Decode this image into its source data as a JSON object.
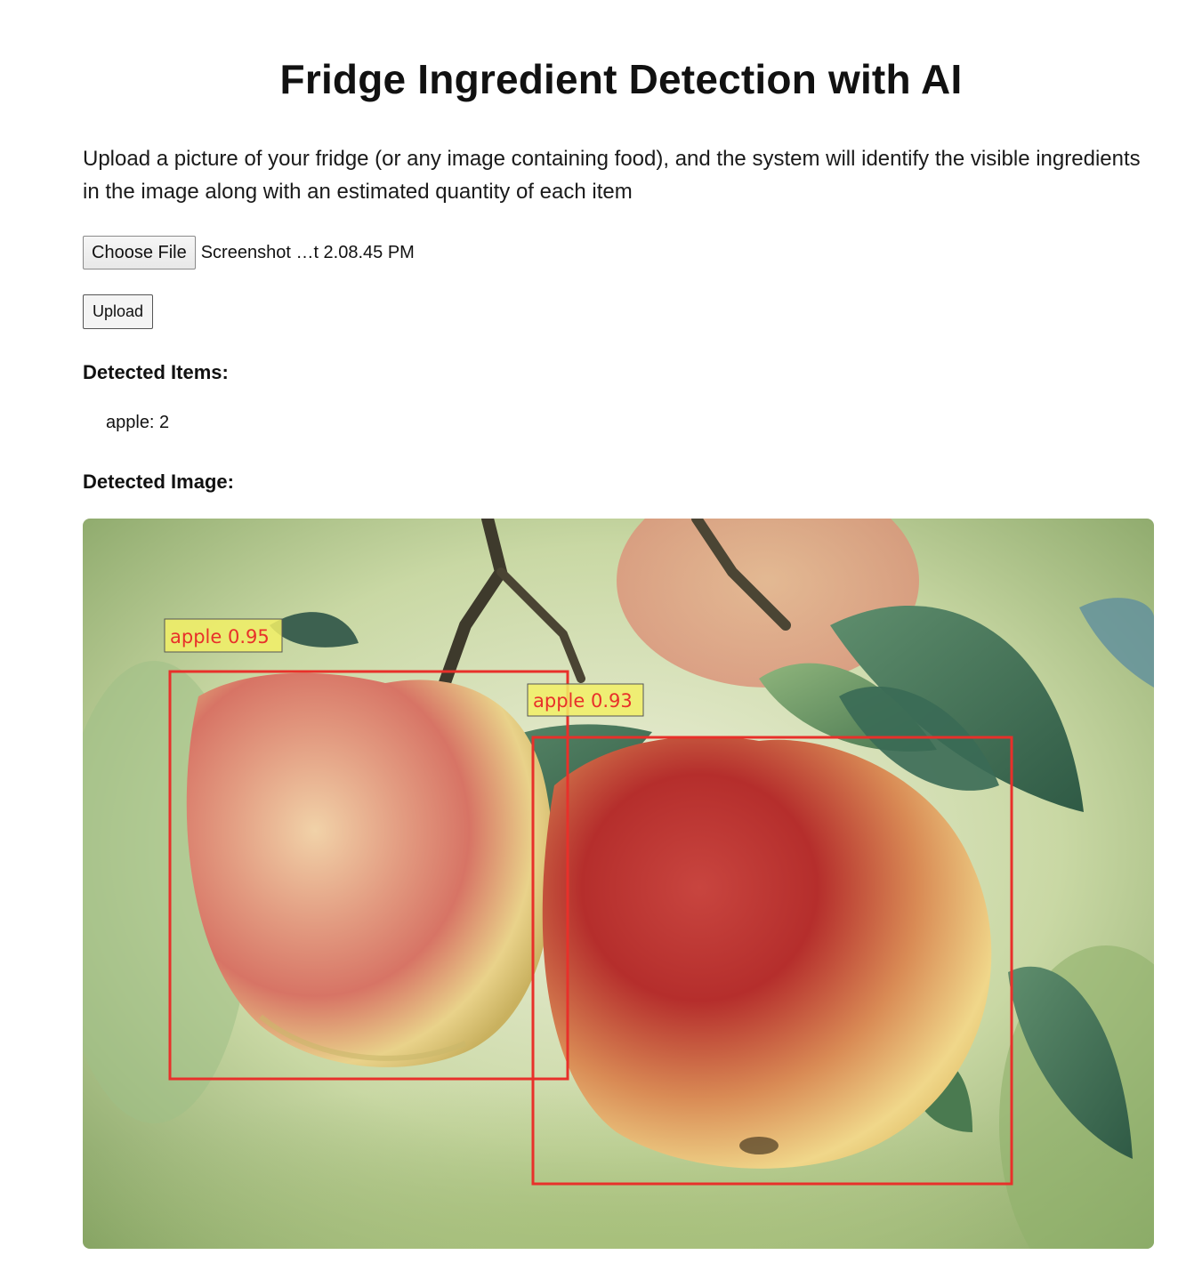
{
  "header": {
    "title": "Fridge Ingredient Detection with AI"
  },
  "intro": {
    "description": "Upload a picture of your fridge (or any image containing food), and the system will identify the visible ingredients in the image along with an estimated quantity of each item"
  },
  "upload_form": {
    "choose_file_label": "Choose File",
    "selected_file": "Screenshot …t 2.08.45 PM",
    "upload_label": "Upload"
  },
  "results": {
    "items_heading": "Detected Items:",
    "items": [
      "apple: 2"
    ],
    "image_heading": "Detected Image:"
  },
  "detections": [
    {
      "label": "apple 0.95",
      "class": "apple",
      "confidence": 0.95
    },
    {
      "label": "apple 0.93",
      "class": "apple",
      "confidence": 0.93
    }
  ],
  "colors": {
    "box": "#e8302a",
    "label_bg": "#f2f066",
    "label_text": "#e8302a"
  }
}
